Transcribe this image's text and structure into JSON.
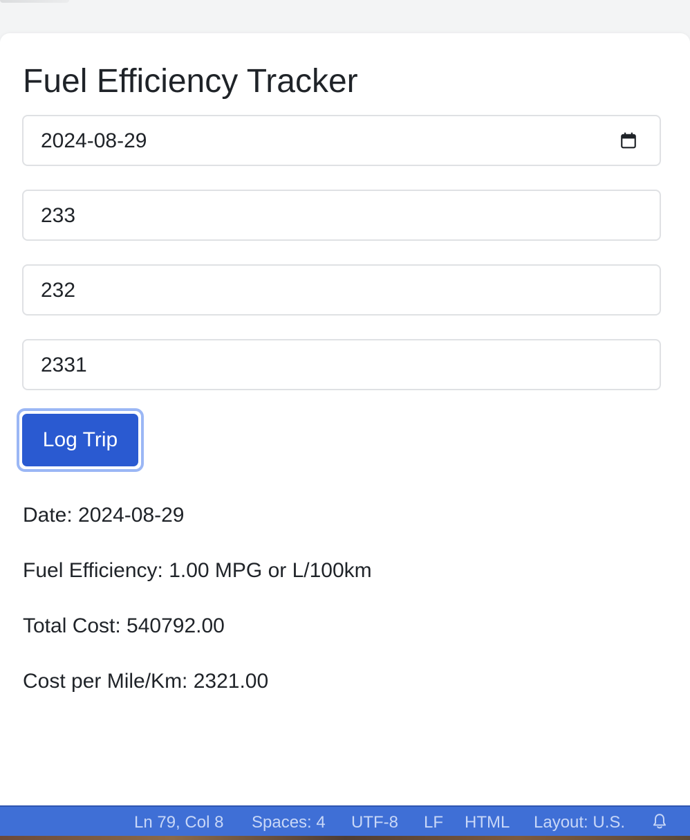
{
  "app": {
    "title": "Fuel Efficiency Tracker"
  },
  "form": {
    "date_value": "2024-08-29",
    "field2_value": "233",
    "field3_value": "232",
    "field4_value": "2331",
    "log_button_label": "Log Trip"
  },
  "results": {
    "date": "Date: 2024-08-29",
    "fuel_efficiency": "Fuel Efficiency: 1.00 MPG or L/100km",
    "total_cost": "Total Cost: 540792.00",
    "cost_per_distance": "Cost per Mile/Km: 2321.00"
  },
  "status_bar": {
    "cursor_position": "Ln 79, Col 8",
    "indentation": "Spaces: 4",
    "encoding": "UTF-8",
    "line_ending": "LF",
    "language": "HTML",
    "keyboard_layout": "Layout: U.S.",
    "notifications_icon": "bell-icon"
  },
  "colors": {
    "accent": "#2a5ad1",
    "focus_ring": "#9bb7f5",
    "status_bar_bg": "#3f6fd6"
  },
  "icons": {
    "date_picker": "calendar-icon",
    "notifications": "bell-icon"
  }
}
